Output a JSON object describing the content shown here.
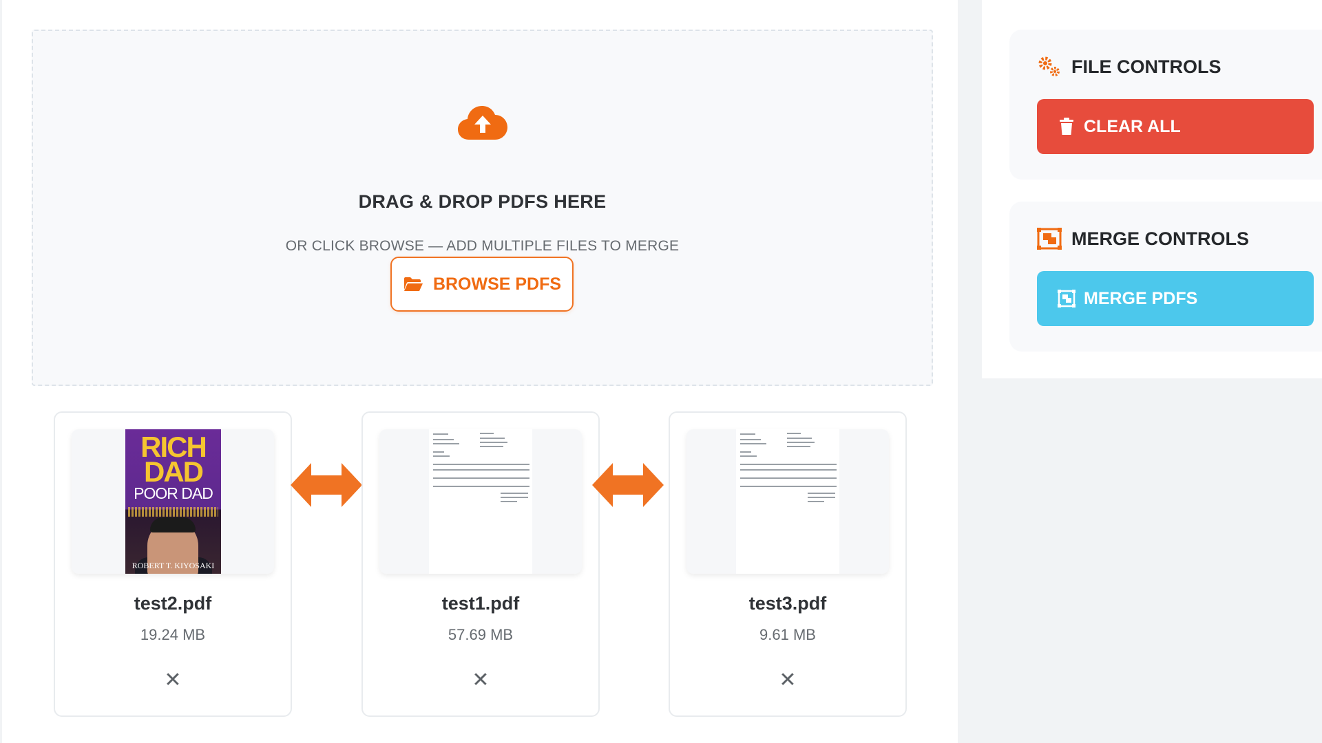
{
  "dropzone": {
    "icon": "cloud-upload-icon",
    "title": "DRAG & DROP PDFS HERE",
    "subtitle": "OR CLICK BROWSE — ADD MULTIPLE FILES TO MERGE",
    "browse_label": "BROWSE PDFS",
    "browse_icon": "folder-open-icon"
  },
  "files": [
    {
      "name": "test2.pdf",
      "size": "19.24 MB",
      "thumbnail": "book-cover",
      "cover_text": {
        "title_1": "RICH",
        "title_2": "DAD",
        "title_3": "POOR DAD",
        "author": "ROBERT T. KIYOSAKI"
      }
    },
    {
      "name": "test1.pdf",
      "size": "57.69 MB",
      "thumbnail": "document-page"
    },
    {
      "name": "test3.pdf",
      "size": "9.61 MB",
      "thumbnail": "document-page"
    }
  ],
  "remove_symbol": "✕",
  "swap_icon": "swap-arrow-icon",
  "file_controls": {
    "title": "FILE CONTROLS",
    "icon": "cogs-icon",
    "clear_label": "CLEAR ALL",
    "clear_icon": "trash-icon",
    "clear_color": "#e74c3c"
  },
  "merge_controls": {
    "title": "MERGE CONTROLS",
    "icon": "object-group-icon",
    "merge_label": "MERGE PDFS",
    "merge_icon": "object-group-icon",
    "merge_color": "#4cc8ec"
  },
  "accent_color": "#f06b12"
}
